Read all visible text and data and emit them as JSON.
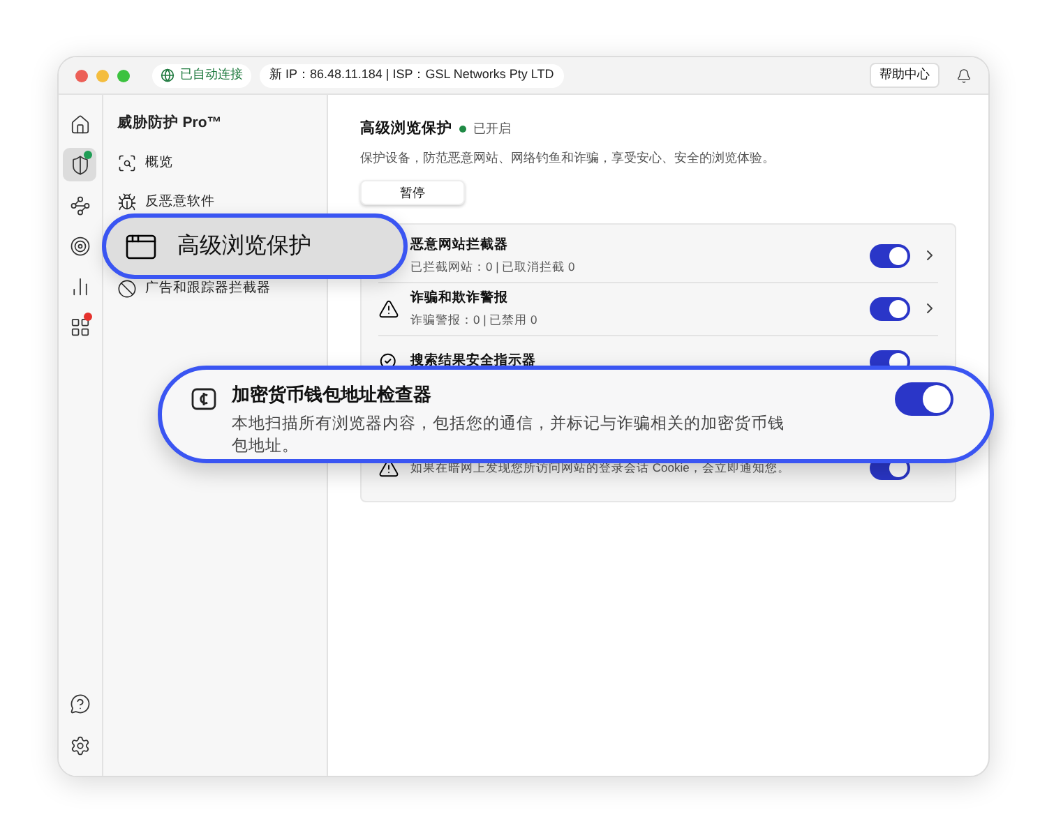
{
  "window": {
    "connection_badge": "已自动连接",
    "ip_info": "新 IP：86.48.11.184 | ISP：GSL Networks Pty LTD",
    "help_button": "帮助中心"
  },
  "rail": [
    {
      "kind": "home",
      "selected": false
    },
    {
      "kind": "shield",
      "selected": true,
      "color": "#1f9d55"
    },
    {
      "kind": "nodes",
      "selected": false
    },
    {
      "kind": "target",
      "selected": false
    },
    {
      "kind": "chart",
      "selected": false
    },
    {
      "kind": "apps",
      "selected": false,
      "color": "#e5322d"
    }
  ],
  "rail_bottom": [
    {
      "kind": "help"
    },
    {
      "kind": "settings"
    }
  ],
  "sidebar": {
    "title": "威胁防护 Pro™",
    "items": [
      {
        "kind": "overview",
        "label": "概览",
        "selected": false
      },
      {
        "kind": "malware",
        "label": "反恶意软件",
        "selected": false
      },
      {
        "kind": "browsing",
        "label": "高级浏览保护",
        "selected": true
      },
      {
        "kind": "ads",
        "label": "广告和跟踪器拦截器",
        "selected": false
      }
    ]
  },
  "main": {
    "title": "高级浏览保护",
    "status": "已开启",
    "status_on": true,
    "description": "保护设备，防范恶意网站、网络钓鱼和诈骗，享受安心、安全的浏览体验。",
    "pause_button": "暂停",
    "features": [
      {
        "kind": "blocker",
        "title": "恶意网站拦截器",
        "subtitle": "已拦截网站：0 | 已取消拦截 0",
        "on": true,
        "chevron": true,
        "highlighted": false
      },
      {
        "kind": "scam",
        "title": "诈骗和欺诈警报",
        "subtitle": "诈骗警报：0 | 已禁用 0",
        "on": true,
        "chevron": true,
        "highlighted": false
      },
      {
        "kind": "search",
        "title": "搜索结果安全指示器",
        "on": true,
        "chevron": false,
        "highlighted": false
      },
      {
        "kind": "crypto",
        "title": "加密货币钱包地址检查器",
        "subtitle": "本地扫描所有浏览器内容，包括您的通信，并标记与诈骗相关的加密货币钱包地址。",
        "on": true,
        "chevron": false,
        "highlighted": true
      },
      {
        "kind": "session",
        "subtitle": "如果在暗网上发现您所访问网站的登录会话 Cookie，会立即通知您。",
        "on": true,
        "chevron": false,
        "highlighted": false
      }
    ]
  }
}
